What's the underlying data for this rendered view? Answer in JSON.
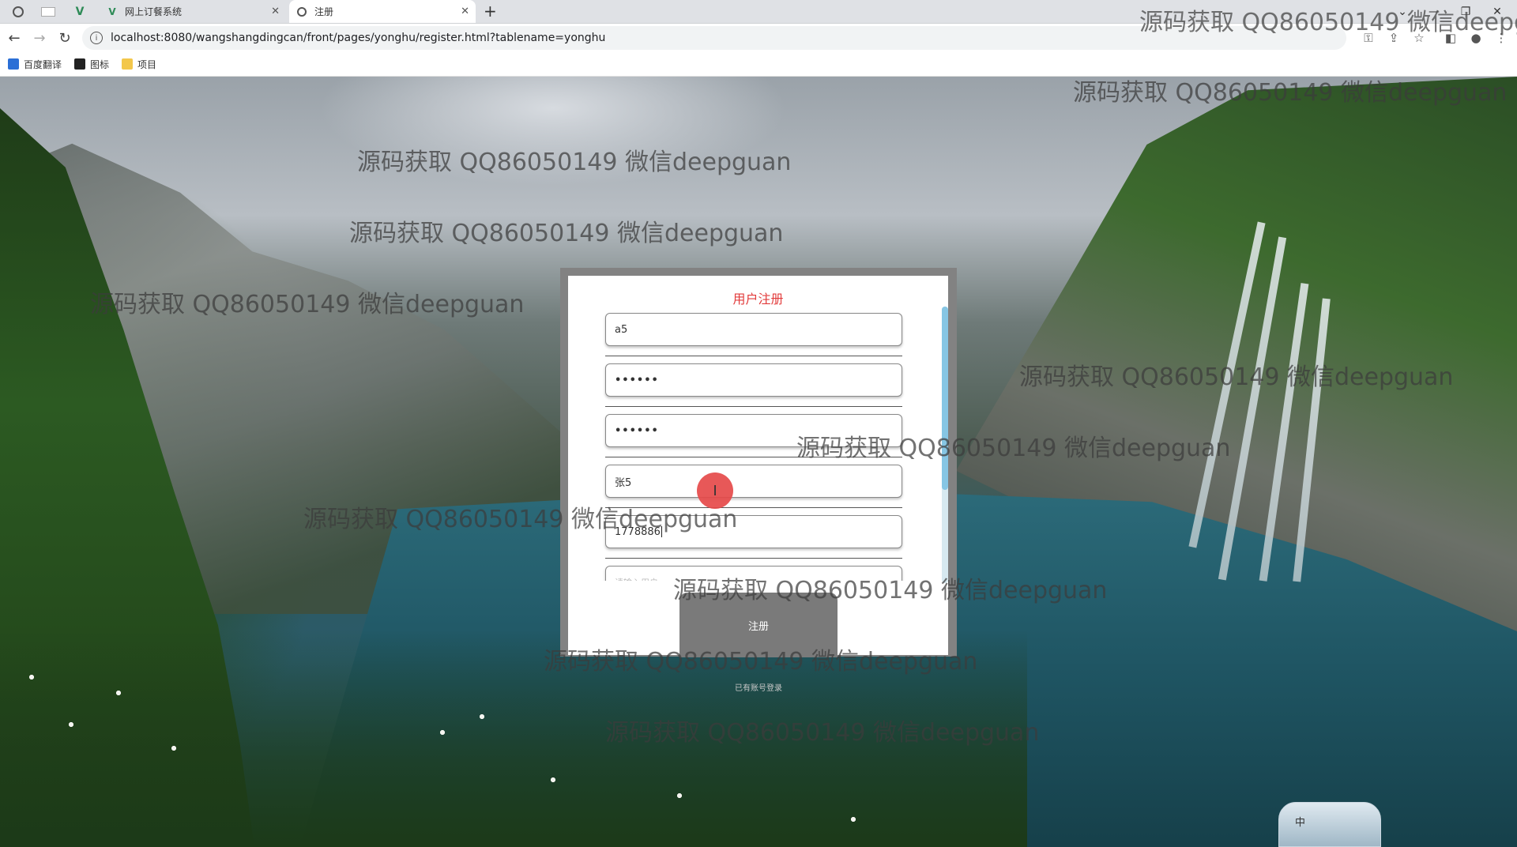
{
  "browser": {
    "tabs": [
      {
        "label": "网上订餐系统",
        "icon": "vue-icon"
      },
      {
        "label": "注册",
        "icon": "globe-icon",
        "active": true
      }
    ],
    "url": "localhost:8080/wangshangdingcan/front/pages/yonghu/register.html?tablename=yonghu",
    "bookmarks": [
      {
        "label": "百度翻译"
      },
      {
        "label": "图标"
      },
      {
        "label": "项目"
      }
    ]
  },
  "form": {
    "title": "用户注册",
    "fields": [
      {
        "value": "a5",
        "type": "text"
      },
      {
        "value": "••••••",
        "type": "password"
      },
      {
        "value": "••••••",
        "type": "password"
      },
      {
        "value": "张5",
        "type": "text"
      },
      {
        "value": "1778886",
        "type": "text"
      },
      {
        "value": "请输入用户",
        "type": "text"
      }
    ],
    "submit_label": "注册",
    "login_link": "已有账号登录"
  },
  "watermark": "源码获取 QQ86050149 微信deepguan",
  "watermark_top": "源码获取 QQ86050149 微信deepg",
  "ime": {
    "label": "中"
  },
  "colors": {
    "title_red": "#e23b3b",
    "panel_gray": "#828282",
    "scroll_blue": "#86c6e4",
    "cursor_red": "#e64a4a"
  }
}
